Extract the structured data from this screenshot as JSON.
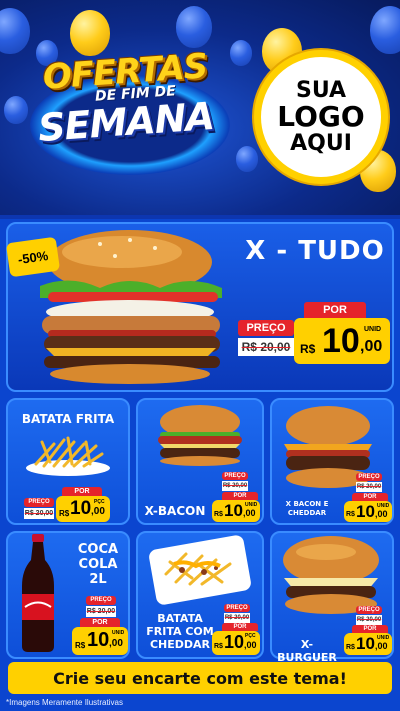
{
  "header": {
    "title_line1": "OFERTAS",
    "title_line2": "DE FIM DE",
    "title_line3": "SEMANA",
    "logo_line1": "SUA",
    "logo_line2": "LOGO",
    "logo_line3": "AQUI"
  },
  "featured": {
    "name": "X - TUDO",
    "discount": "-50%",
    "preco_label": "PREÇO",
    "old_price": "R$ 20,00",
    "por_label": "POR",
    "currency": "R$",
    "price": "10",
    "cents": ",00",
    "unit": "UNID"
  },
  "items": [
    {
      "name": "BATATA FRITA",
      "preco_label": "PREÇO",
      "old_price": "R$ 20,00",
      "por_label": "POR",
      "currency": "R$",
      "price": "10",
      "cents": ",00",
      "unit": "PÇC"
    },
    {
      "name": "X-BACON",
      "preco_label": "PREÇO",
      "old_price": "R$ 20,00",
      "por_label": "POR",
      "currency": "R$",
      "price": "10",
      "cents": ",00",
      "unit": "UNID"
    },
    {
      "name": "X BACON E CHEDDAR",
      "preco_label": "PREÇO",
      "old_price": "R$ 20,00",
      "por_label": "POR",
      "currency": "R$",
      "price": "10",
      "cents": ",00",
      "unit": "UNID"
    },
    {
      "name": "COCA COLA 2L",
      "preco_label": "PREÇO",
      "old_price": "R$ 20,00",
      "por_label": "POR",
      "currency": "R$",
      "price": "10",
      "cents": ",00",
      "unit": "UNID"
    },
    {
      "name": "BATATA FRITA COM CHEDDAR",
      "preco_label": "PREÇO",
      "old_price": "R$ 20,00",
      "por_label": "POR",
      "currency": "R$",
      "price": "10",
      "cents": ",00",
      "unit": "PÇC"
    },
    {
      "name": "X-BURGUER",
      "preco_label": "PREÇO",
      "old_price": "R$ 20,00",
      "por_label": "POR",
      "currency": "R$",
      "price": "10",
      "cents": ",00",
      "unit": "UNID"
    }
  ],
  "banner": {
    "text": "Crie seu encarte com este tema!"
  },
  "footer": {
    "note": "*Imagens Meramente Ilustrativas"
  },
  "colors": {
    "background": "#0b45cf",
    "accent_yellow": "#ffd000",
    "accent_red": "#e5242b",
    "card_blue": "#1e6bf0"
  },
  "icons": [
    "balloon-icon",
    "burger-image",
    "fries-image",
    "soda-bottle-image"
  ]
}
